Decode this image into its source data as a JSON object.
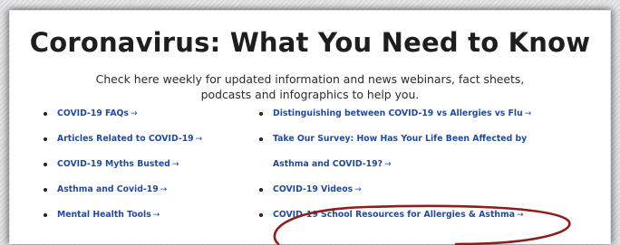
{
  "header": {
    "title": "Coronavirus: What You Need to Know"
  },
  "intro": {
    "line1": "Check here weekly for updated information and news webinars, fact sheets,",
    "line2": "podcasts and infographics to help you."
  },
  "links": {
    "left": [
      {
        "label": "COVID-19 FAQs"
      },
      {
        "label": "Articles Related to COVID-19"
      },
      {
        "label": "COVID-19 Myths Busted"
      },
      {
        "label": "Asthma and Covid-19"
      },
      {
        "label": "Mental Health Tools"
      }
    ],
    "right": [
      {
        "label": "Distinguishing between COVID-19 vs Allergies vs Flu"
      },
      {
        "label": "Take Our Survey: How Has Your Life Been Affected by"
      },
      {
        "label": "Asthma and COVID-19?"
      },
      {
        "label": "COVID-19 Videos"
      },
      {
        "label": "COVID-19 School Resources for Allergies & Asthma"
      }
    ]
  },
  "icons": {
    "link_arrow": "right-arrow-icon",
    "list_bullet": "bullet-icon",
    "highlight": "circled-annotation"
  },
  "colors": {
    "link": "#214b9e",
    "title": "#1e1e1e",
    "annotation": "#8a1f1f"
  }
}
